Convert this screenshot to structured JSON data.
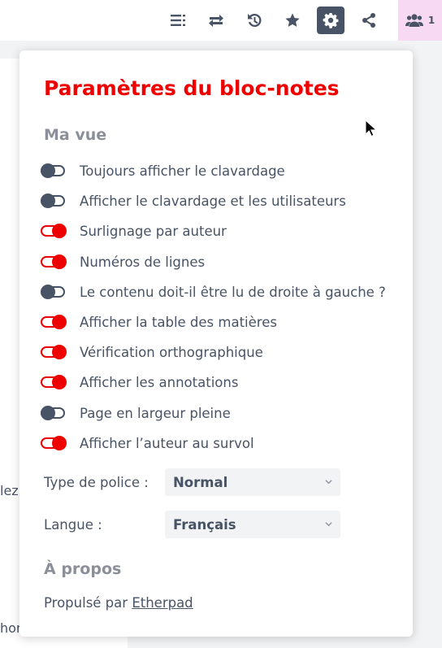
{
  "toolbar": {
    "buttons": [
      {
        "icon": "list-icon"
      },
      {
        "icon": "import-export-icon"
      },
      {
        "icon": "history-icon"
      },
      {
        "icon": "star-icon"
      },
      {
        "icon": "gear-icon",
        "active": true
      },
      {
        "icon": "share-icon"
      }
    ],
    "users": {
      "icon": "users-icon",
      "count": "1"
    }
  },
  "editor": {
    "fragments": [
      "lez",
      "hor"
    ]
  },
  "settings": {
    "title": "Paramètres du bloc-notes",
    "my_view_title": "Ma vue",
    "options": [
      {
        "label": "Toujours afficher le clavardage",
        "checked": false
      },
      {
        "label": "Afficher le clavardage et les utilisateurs",
        "checked": false
      },
      {
        "label": "Surlignage par auteur",
        "checked": true
      },
      {
        "label": "Numéros de lignes",
        "checked": true
      },
      {
        "label": "Le contenu doit-il être lu de droite à gauche ?",
        "checked": false
      },
      {
        "label": "Afficher la table des matières",
        "checked": true
      },
      {
        "label": "Vérification orthographique",
        "checked": true
      },
      {
        "label": "Afficher les annotations",
        "checked": true
      },
      {
        "label": "Page en largeur pleine",
        "checked": false
      },
      {
        "label": "Afficher l’auteur au survol",
        "checked": true
      }
    ],
    "font_type_label": "Type de police :",
    "font_type_value": "Normal",
    "language_label": "Langue :",
    "language_value": "Français",
    "about_title": "À propos",
    "powered_by": "Propulsé par",
    "powered_link": "Etherpad"
  },
  "colors": {
    "accent": "#ee0000",
    "text": "#485365",
    "users_bg": "#f7d9f3"
  }
}
